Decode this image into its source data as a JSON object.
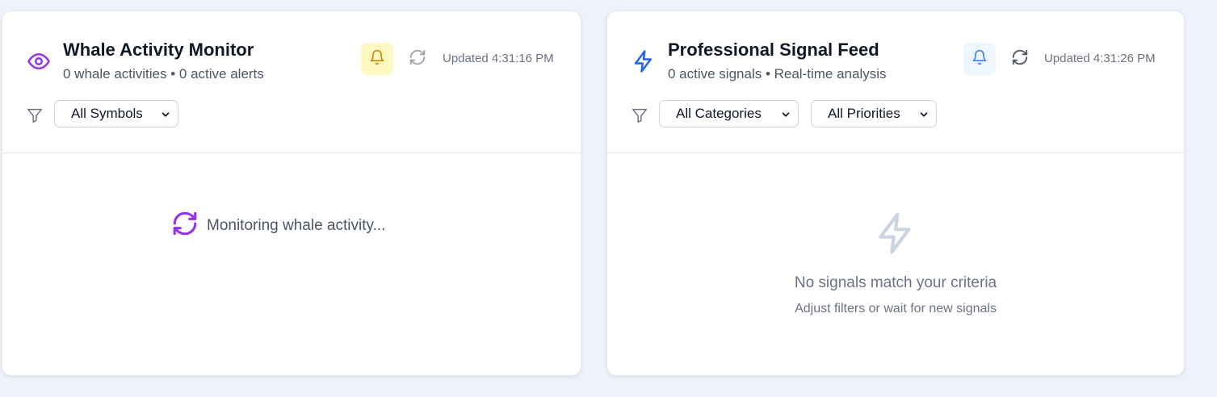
{
  "colors": {
    "whale_accent": "#9333ea",
    "signal_accent": "#2563eb",
    "whale_bell_bg": "#fef9c3",
    "whale_bell_icon": "#ca8a04",
    "signal_bell_bg": "#eff6ff",
    "signal_bell_icon": "#3b82f6",
    "page_bg": "#eef3fb"
  },
  "whale_panel": {
    "icon": "eye-icon",
    "title": "Whale Activity Monitor",
    "subtitle": "0 whale activities • 0 active alerts",
    "updated": "Updated 4:31:16 PM",
    "filters": {
      "symbol_select": "All Symbols"
    },
    "loading_icon": "refresh-spin-icon",
    "loading_text": "Monitoring whale activity..."
  },
  "signal_panel": {
    "icon": "lightning-icon",
    "title": "Professional Signal Feed",
    "subtitle": "0 active signals • Real-time analysis",
    "updated": "Updated 4:31:26 PM",
    "filters": {
      "category_select": "All Categories",
      "priority_select": "All Priorities"
    },
    "empty_icon": "lightning-icon",
    "empty_title": "No signals match your criteria",
    "empty_sub": "Adjust filters or wait for new signals"
  }
}
